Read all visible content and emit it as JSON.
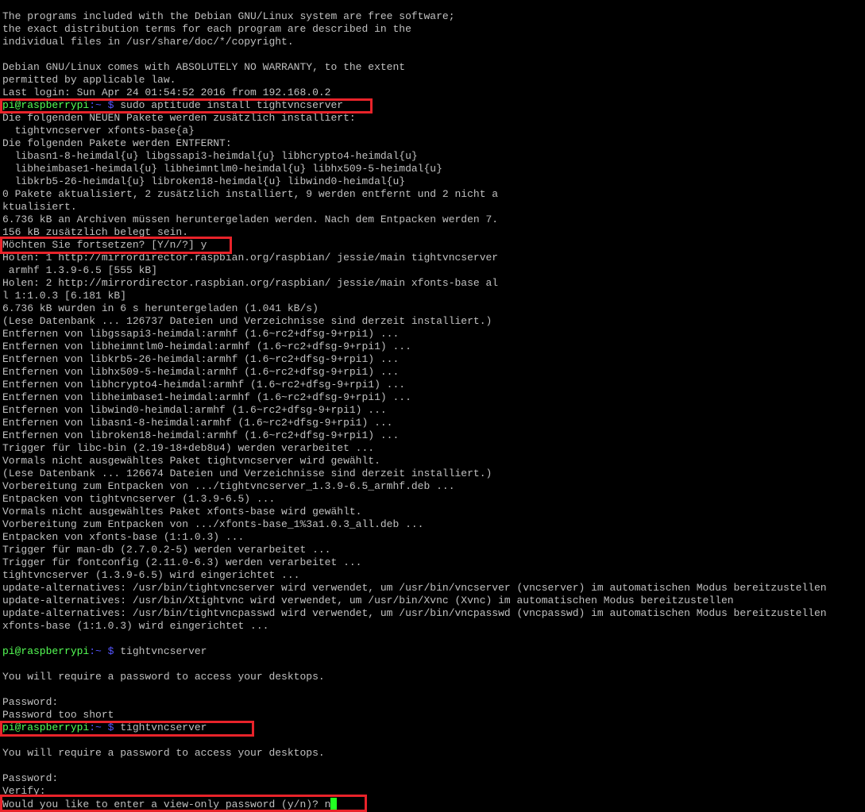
{
  "terminal": {
    "prompt_user": "pi@raspberrypi",
    "prompt_path": ":~ $",
    "lines": [
      {
        "text": "The programs included with the Debian GNU/Linux system are free software;"
      },
      {
        "text": "the exact distribution terms for each program are described in the"
      },
      {
        "text": "individual files in /usr/share/doc/*/copyright."
      },
      {
        "text": ""
      },
      {
        "text": "Debian GNU/Linux comes with ABSOLUTELY NO WARRANTY, to the extent"
      },
      {
        "text": "permitted by applicable law."
      },
      {
        "text": "Last login: Sun Apr 24 01:54:52 2016 from 192.168.0.2"
      },
      {
        "prompt": true,
        "command": "sudo aptitude install tightvncserver"
      },
      {
        "text": "Die folgenden NEUEN Pakete werden zusätzlich installiert:"
      },
      {
        "text": "  tightvncserver xfonts-base{a}"
      },
      {
        "text": "Die folgenden Pakete werden ENTFERNT:"
      },
      {
        "text": "  libasn1-8-heimdal{u} libgssapi3-heimdal{u} libhcrypto4-heimdal{u}"
      },
      {
        "text": "  libheimbase1-heimdal{u} libheimntlm0-heimdal{u} libhx509-5-heimdal{u}"
      },
      {
        "text": "  libkrb5-26-heimdal{u} libroken18-heimdal{u} libwind0-heimdal{u}"
      },
      {
        "text": "0 Pakete aktualisiert, 2 zusätzlich installiert, 9 werden entfernt und 2 nicht a"
      },
      {
        "text": "ktualisiert."
      },
      {
        "text": "6.736 kB an Archiven müssen heruntergeladen werden. Nach dem Entpacken werden 7."
      },
      {
        "text": "156 kB zusätzlich belegt sein."
      },
      {
        "text": "Möchten Sie fortsetzen? [Y/n/?] y"
      },
      {
        "text": "Holen: 1 http://mirrordirector.raspbian.org/raspbian/ jessie/main tightvncserver"
      },
      {
        "text": " armhf 1.3.9-6.5 [555 kB]"
      },
      {
        "text": "Holen: 2 http://mirrordirector.raspbian.org/raspbian/ jessie/main xfonts-base al"
      },
      {
        "text": "l 1:1.0.3 [6.181 kB]"
      },
      {
        "text": "6.736 kB wurden in 6 s heruntergeladen (1.041 kB/s)"
      },
      {
        "text": "(Lese Datenbank ... 126737 Dateien und Verzeichnisse sind derzeit installiert.)"
      },
      {
        "text": "Entfernen von libgssapi3-heimdal:armhf (1.6~rc2+dfsg-9+rpi1) ..."
      },
      {
        "text": "Entfernen von libheimntlm0-heimdal:armhf (1.6~rc2+dfsg-9+rpi1) ..."
      },
      {
        "text": "Entfernen von libkrb5-26-heimdal:armhf (1.6~rc2+dfsg-9+rpi1) ..."
      },
      {
        "text": "Entfernen von libhx509-5-heimdal:armhf (1.6~rc2+dfsg-9+rpi1) ..."
      },
      {
        "text": "Entfernen von libhcrypto4-heimdal:armhf (1.6~rc2+dfsg-9+rpi1) ..."
      },
      {
        "text": "Entfernen von libheimbase1-heimdal:armhf (1.6~rc2+dfsg-9+rpi1) ..."
      },
      {
        "text": "Entfernen von libwind0-heimdal:armhf (1.6~rc2+dfsg-9+rpi1) ..."
      },
      {
        "text": "Entfernen von libasn1-8-heimdal:armhf (1.6~rc2+dfsg-9+rpi1) ..."
      },
      {
        "text": "Entfernen von libroken18-heimdal:armhf (1.6~rc2+dfsg-9+rpi1) ..."
      },
      {
        "text": "Trigger für libc-bin (2.19-18+deb8u4) werden verarbeitet ..."
      },
      {
        "text": "Vormals nicht ausgewähltes Paket tightvncserver wird gewählt."
      },
      {
        "text": "(Lese Datenbank ... 126674 Dateien und Verzeichnisse sind derzeit installiert.)"
      },
      {
        "text": "Vorbereitung zum Entpacken von .../tightvncserver_1.3.9-6.5_armhf.deb ..."
      },
      {
        "text": "Entpacken von tightvncserver (1.3.9-6.5) ..."
      },
      {
        "text": "Vormals nicht ausgewähltes Paket xfonts-base wird gewählt."
      },
      {
        "text": "Vorbereitung zum Entpacken von .../xfonts-base_1%3a1.0.3_all.deb ..."
      },
      {
        "text": "Entpacken von xfonts-base (1:1.0.3) ..."
      },
      {
        "text": "Trigger für man-db (2.7.0.2-5) werden verarbeitet ..."
      },
      {
        "text": "Trigger für fontconfig (2.11.0-6.3) werden verarbeitet ..."
      },
      {
        "text": "tightvncserver (1.3.9-6.5) wird eingerichtet ..."
      },
      {
        "text": "update-alternatives: /usr/bin/tightvncserver wird verwendet, um /usr/bin/vncserver (vncserver) im automatischen Modus bereitzustellen"
      },
      {
        "text": "update-alternatives: /usr/bin/Xtightvnc wird verwendet, um /usr/bin/Xvnc (Xvnc) im automatischen Modus bereitzustellen"
      },
      {
        "text": "update-alternatives: /usr/bin/tightvncpasswd wird verwendet, um /usr/bin/vncpasswd (vncpasswd) im automatischen Modus bereitzustellen"
      },
      {
        "text": "xfonts-base (1:1.0.3) wird eingerichtet ..."
      },
      {
        "text": ""
      },
      {
        "prompt": true,
        "command": "tightvncserver"
      },
      {
        "text": ""
      },
      {
        "text": "You will require a password to access your desktops."
      },
      {
        "text": ""
      },
      {
        "text": "Password:"
      },
      {
        "text": "Password too short"
      },
      {
        "prompt": true,
        "command": "tightvncserver"
      },
      {
        "text": ""
      },
      {
        "text": "You will require a password to access your desktops."
      },
      {
        "text": ""
      },
      {
        "text": "Password:"
      },
      {
        "text": "Verify:"
      },
      {
        "text": "Would you like to enter a view-only password (y/n)? n",
        "cursor": true
      }
    ]
  }
}
